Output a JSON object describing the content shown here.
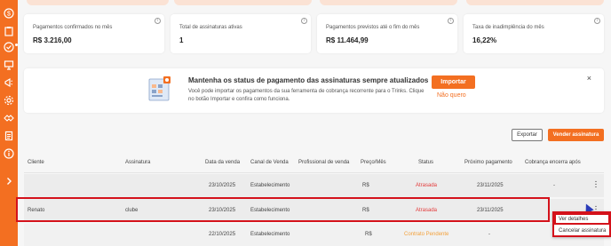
{
  "sidebar": {
    "icons": [
      "dollar-icon",
      "clipboard-icon",
      "check-circle-icon",
      "presentation-icon",
      "megaphone-icon",
      "settings-icon",
      "handshake-icon",
      "document-icon",
      "info-icon",
      "chevron-right-icon"
    ],
    "accent": "#f36f21"
  },
  "metrics": [
    {
      "label": "Pagamentos confirmados no mês",
      "value": "R$ 3.216,00"
    },
    {
      "label": "Total de assinaturas ativas",
      "value": "1"
    },
    {
      "label": "Pagamentos previstos até o fim do mês",
      "value": "R$ 11.464,99"
    },
    {
      "label": "Taxa de inadimplência do mês",
      "value": "16,22%"
    }
  ],
  "banner": {
    "title": "Mantenha os status de pagamento das assinaturas sempre atualizados",
    "text": "Você pode importar os pagamentos da sua ferramenta de cobrança recorrente para o Trinks. Clique no botão Importar e confira como funciona.",
    "import_label": "Importar",
    "dismiss_label": "Não quero",
    "close_glyph": "×"
  },
  "actions": {
    "export_label": "Exportar",
    "sell_label": "Vender assinatura"
  },
  "table": {
    "headers": [
      "Cliente",
      "Assinatura",
      "Data da venda",
      "Canal de Venda",
      "Profissional de venda",
      "Preço/Mês",
      "Status",
      "Próximo pagamento",
      "Cobrança encerra após"
    ],
    "rows": [
      {
        "client": "",
        "plan": "",
        "date": "23/10/2025",
        "channel": "Estabelecimento",
        "pro": "",
        "price": "R$",
        "status": "Atrasada",
        "next": "23/11/2025",
        "ends": "-"
      },
      {
        "client": "Renato",
        "plan": "clube",
        "date": "23/10/2025",
        "channel": "Estabelecimento",
        "pro": "",
        "price": "R$",
        "status": "Atrasada",
        "next": "23/11/2025",
        "ends": ""
      },
      {
        "client": "",
        "plan": "",
        "date": "22/10/2025",
        "channel": "Estabelecimento",
        "pro": "",
        "price": "R$",
        "status": "Contrato Pendente",
        "next": "-",
        "ends": ""
      }
    ]
  },
  "context_menu": {
    "items": [
      "Ver detalhes",
      "Cancelar assinatura"
    ]
  },
  "colors": {
    "overdue": "#e33a3a",
    "pending": "#f3a13b",
    "highlight": "#d4121b"
  }
}
